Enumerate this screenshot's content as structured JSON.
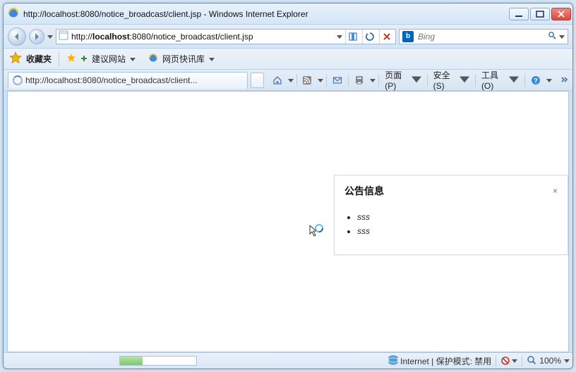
{
  "title": {
    "url": "http://localhost:8080/notice_broadcast/client.jsp",
    "app": "Windows Internet Explorer"
  },
  "address": {
    "prefix": "http://",
    "host": "localhost",
    "rest": ":8080/notice_broadcast/client.jsp"
  },
  "search": {
    "placeholder": "Bing"
  },
  "favorites": {
    "label": "收藏夹",
    "suggest": "建议网站",
    "quick": "网页快讯库"
  },
  "tab": {
    "label": "http://localhost:8080/notice_broadcast/client..."
  },
  "commands": {
    "page": "页面(P)",
    "safety": "安全(S)",
    "tools": "工具(O)"
  },
  "notice": {
    "title": "公告信息",
    "close": "×",
    "items": [
      "sss",
      "sss"
    ]
  },
  "status": {
    "zone": "Internet | 保护模式: 禁用",
    "zoom": "100%"
  }
}
